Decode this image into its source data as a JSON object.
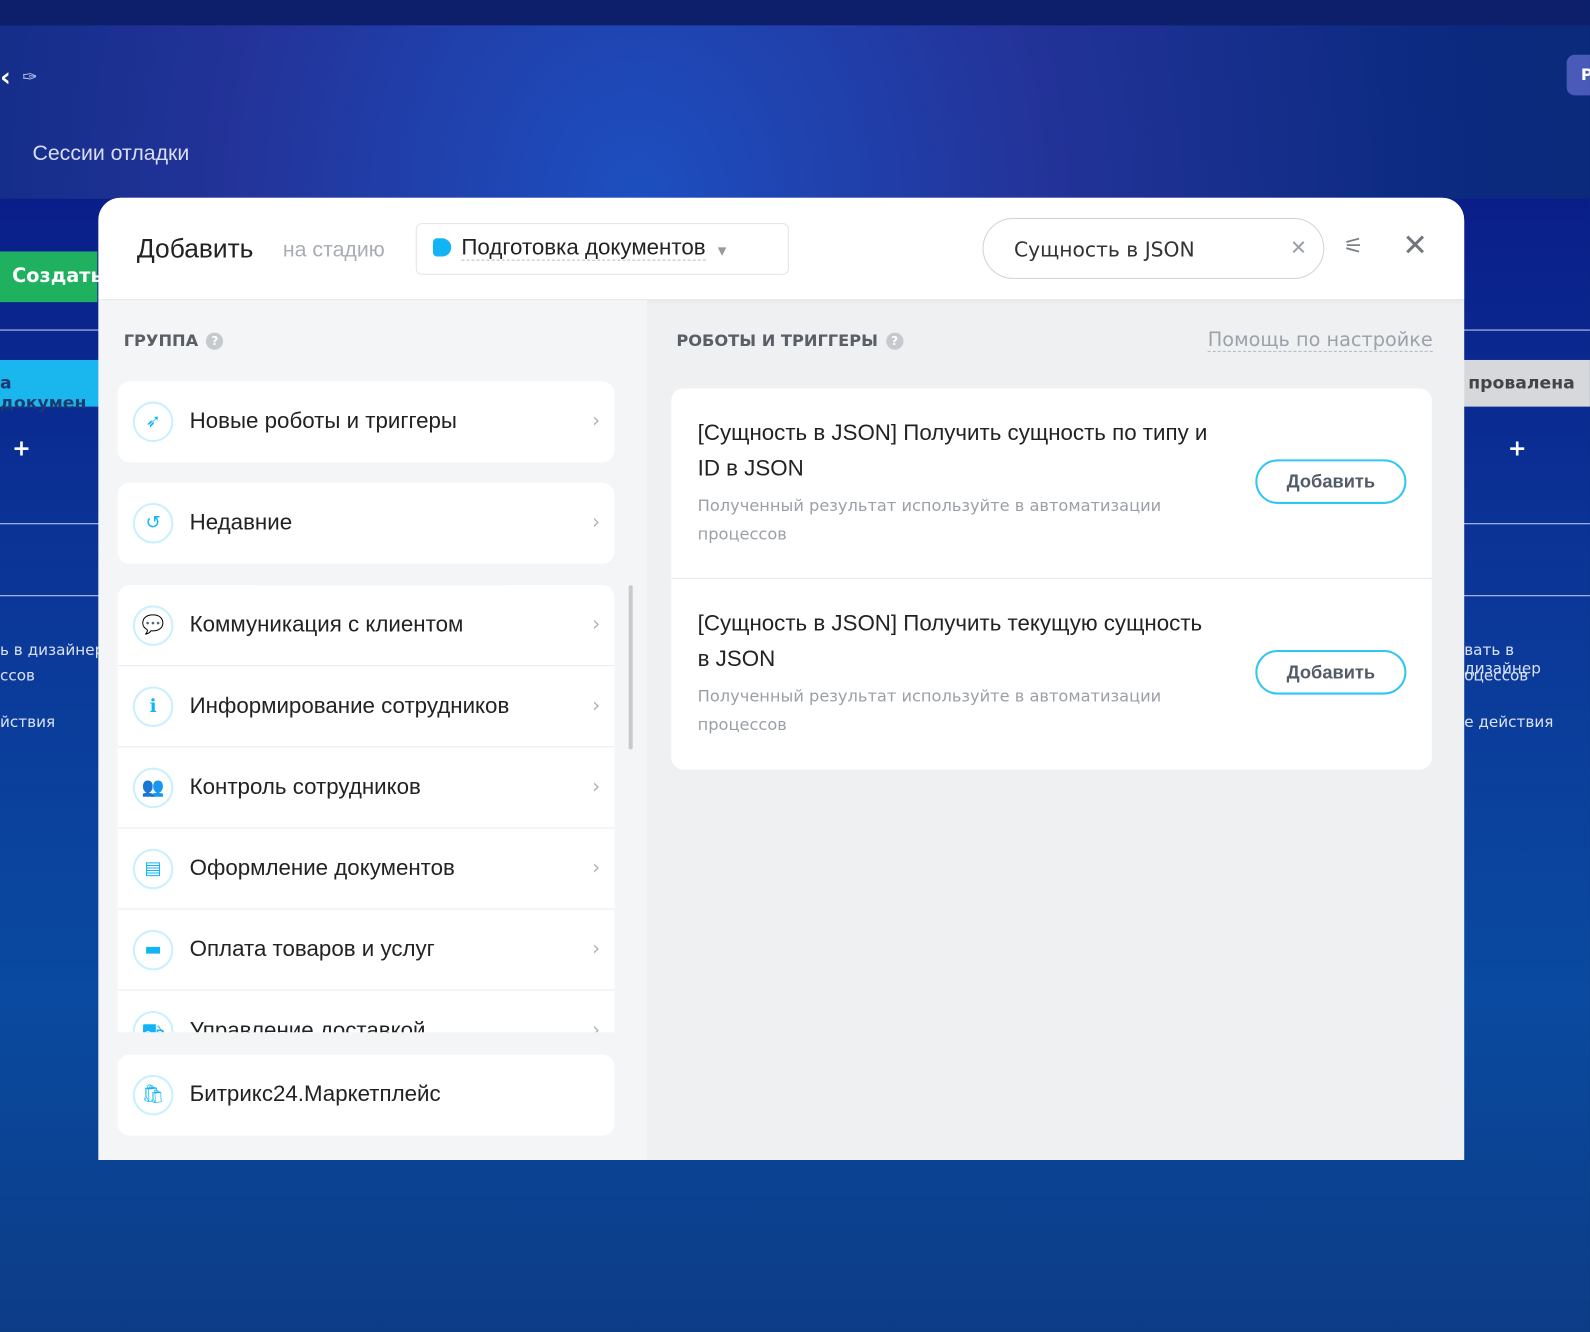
{
  "background": {
    "back_glyph": "‹",
    "page_title": "Сессии отладки",
    "create_button": "Создать",
    "right_button": "Р",
    "left_stage": "а докумен",
    "right_stage": "провалена",
    "plus": "+",
    "left_texts": [
      "ь в дизайнере",
      "ссов",
      "йствия"
    ],
    "right_texts": [
      "вать в дизайнер",
      "оцессов",
      "е действия"
    ]
  },
  "modal": {
    "title": "Добавить",
    "subtitle": "на стадию",
    "stage": "Подготовка документов",
    "stage_color": "#12b4f5",
    "search_value": "Сущность в JSON",
    "group_header": "ГРУППА",
    "robots_header": "РОБОТЫ И ТРИГГЕРЫ",
    "help_link": "Помощь по настройке",
    "top_groups": [
      {
        "label": "Новые роботы и триггеры",
        "icon": "rocket-icon"
      },
      {
        "label": "Недавние",
        "icon": "history-icon"
      }
    ],
    "groups": [
      {
        "label": "Коммуникация с клиентом",
        "icon": "chat-icon"
      },
      {
        "label": "Информирование сотрудников",
        "icon": "info-icon"
      },
      {
        "label": "Контроль сотрудников",
        "icon": "users-icon"
      },
      {
        "label": "Оформление документов",
        "icon": "document-icon"
      },
      {
        "label": "Оплата товаров и услуг",
        "icon": "wallet-icon"
      },
      {
        "label": "Управление доставкой",
        "icon": "truck-icon"
      }
    ],
    "marketplace": "Битрикс24.Маркетплейс",
    "robots": [
      {
        "title": "[Сущность в JSON] Получить сущность по типу и ID в JSON",
        "desc": "Полученный результат используйте в автоматизации процессов",
        "button": "Добавить"
      },
      {
        "title": "[Сущность в JSON] Получить текущую сущность в JSON",
        "desc": "Полученный результат используйте в автоматизации процессов",
        "button": "Добавить"
      }
    ]
  }
}
